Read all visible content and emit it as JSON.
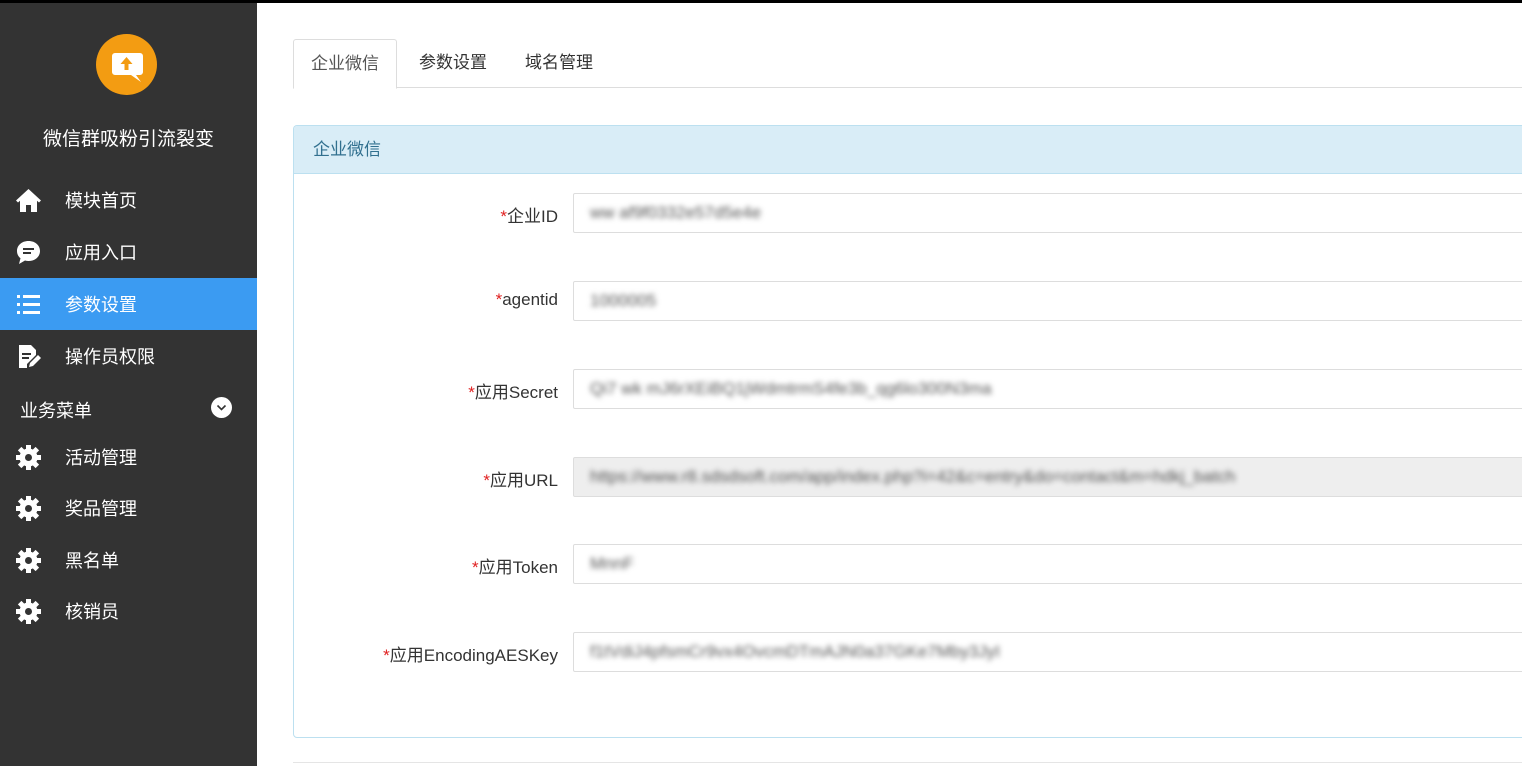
{
  "sidebar": {
    "app_title": "微信群吸粉引流裂变",
    "items": [
      {
        "label": "模块首页",
        "icon": "home-icon"
      },
      {
        "label": "应用入口",
        "icon": "chat-icon"
      },
      {
        "label": "参数设置",
        "icon": "list-icon",
        "active": true
      },
      {
        "label": "操作员权限",
        "icon": "document-edit-icon"
      }
    ],
    "section": {
      "label": "业务菜单",
      "icon": "chevron-down-icon"
    },
    "business_items": [
      {
        "label": "活动管理",
        "icon": "gear-icon"
      },
      {
        "label": "奖品管理",
        "icon": "gear-icon"
      },
      {
        "label": "黑名单",
        "icon": "gear-icon"
      },
      {
        "label": "核销员",
        "icon": "gear-icon"
      }
    ]
  },
  "tabs": [
    {
      "label": "企业微信",
      "active": true
    },
    {
      "label": "参数设置"
    },
    {
      "label": "域名管理"
    }
  ],
  "panel": {
    "heading": "企业微信",
    "fields": [
      {
        "required": "*",
        "label": "企业ID",
        "value": "ww af9f0332e57d5e4e"
      },
      {
        "required": "*",
        "label": "agentid",
        "value": "1000005"
      },
      {
        "required": "*",
        "label": "应用Secret",
        "value": "Qi7 wk mJ6rXEiBQ1jWdmtrmS4fe3b_qg6lo300N3ma"
      },
      {
        "required": "*",
        "label": "应用URL",
        "value": "https://www.r8.sdsdsoft.com/app/index.php?i=42&c=entry&do=contact&m=hdkj_batch",
        "readonly": true
      },
      {
        "required": "*",
        "label": "应用Token",
        "value": "MnnF"
      },
      {
        "required": "*",
        "label": "应用EncodingAESKey",
        "value": "f1tVdiJ4pfsmCr9vx4OvcmDTmAJN0a37GKe7Mby3JyI"
      }
    ]
  },
  "colors": {
    "sidebar_bg": "#333333",
    "active_item": "#3b9bf2",
    "logo": "#f39c12",
    "panel_heading_bg": "#d9edf7",
    "panel_heading_text": "#31708f",
    "required": "#e02020"
  }
}
